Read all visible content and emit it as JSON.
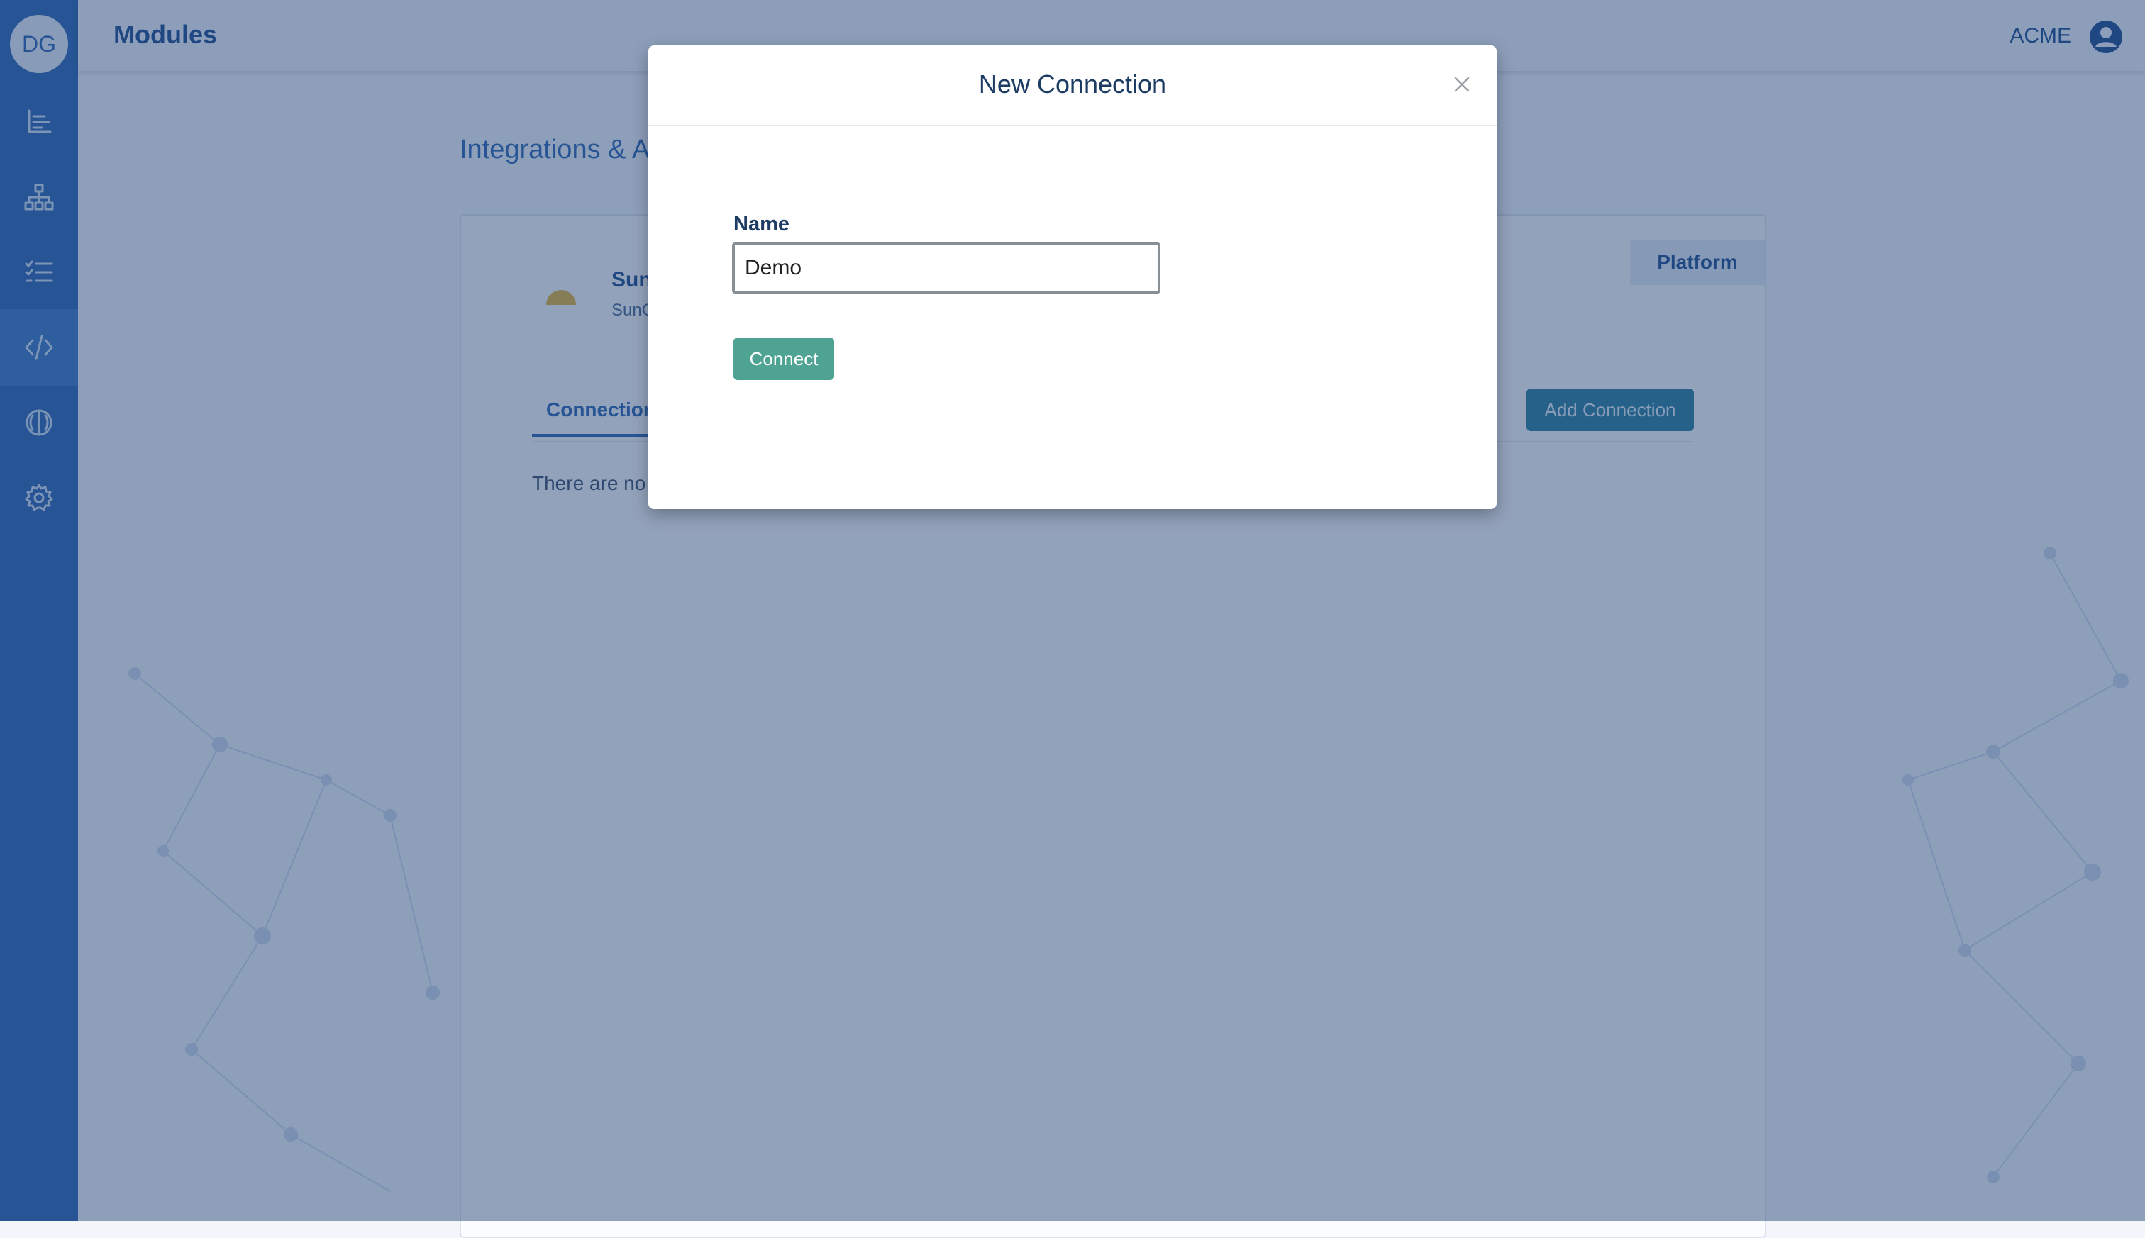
{
  "sidebar": {
    "user_initials": "DG",
    "items": [
      {
        "icon": "chart-icon",
        "active": false
      },
      {
        "icon": "hierarchy-icon",
        "active": false
      },
      {
        "icon": "checklist-icon",
        "active": false
      },
      {
        "icon": "code-icon",
        "active": true
      },
      {
        "icon": "brain-icon",
        "active": false
      },
      {
        "icon": "gear-icon",
        "active": false
      }
    ]
  },
  "header": {
    "title": "Modules",
    "org_name": "ACME",
    "user_icon": "user-circle-icon"
  },
  "main": {
    "section_title": "Integrations & A",
    "platform_label": "Platform",
    "integration": {
      "name": "Sun",
      "subtitle": "SunC"
    },
    "tabs": [
      {
        "label": "Connection"
      }
    ],
    "add_connection_label": "Add Connection",
    "empty_text": "There are no"
  },
  "modal": {
    "title": "New Connection",
    "close_icon": "close-icon",
    "name_label": "Name",
    "name_value": "Demo",
    "connect_label": "Connect"
  },
  "colors": {
    "sidebar": "#2c66b3",
    "accent": "#2c66b3",
    "connect_button": "#4ea393",
    "add_connection_button": "#2b7fa0"
  }
}
